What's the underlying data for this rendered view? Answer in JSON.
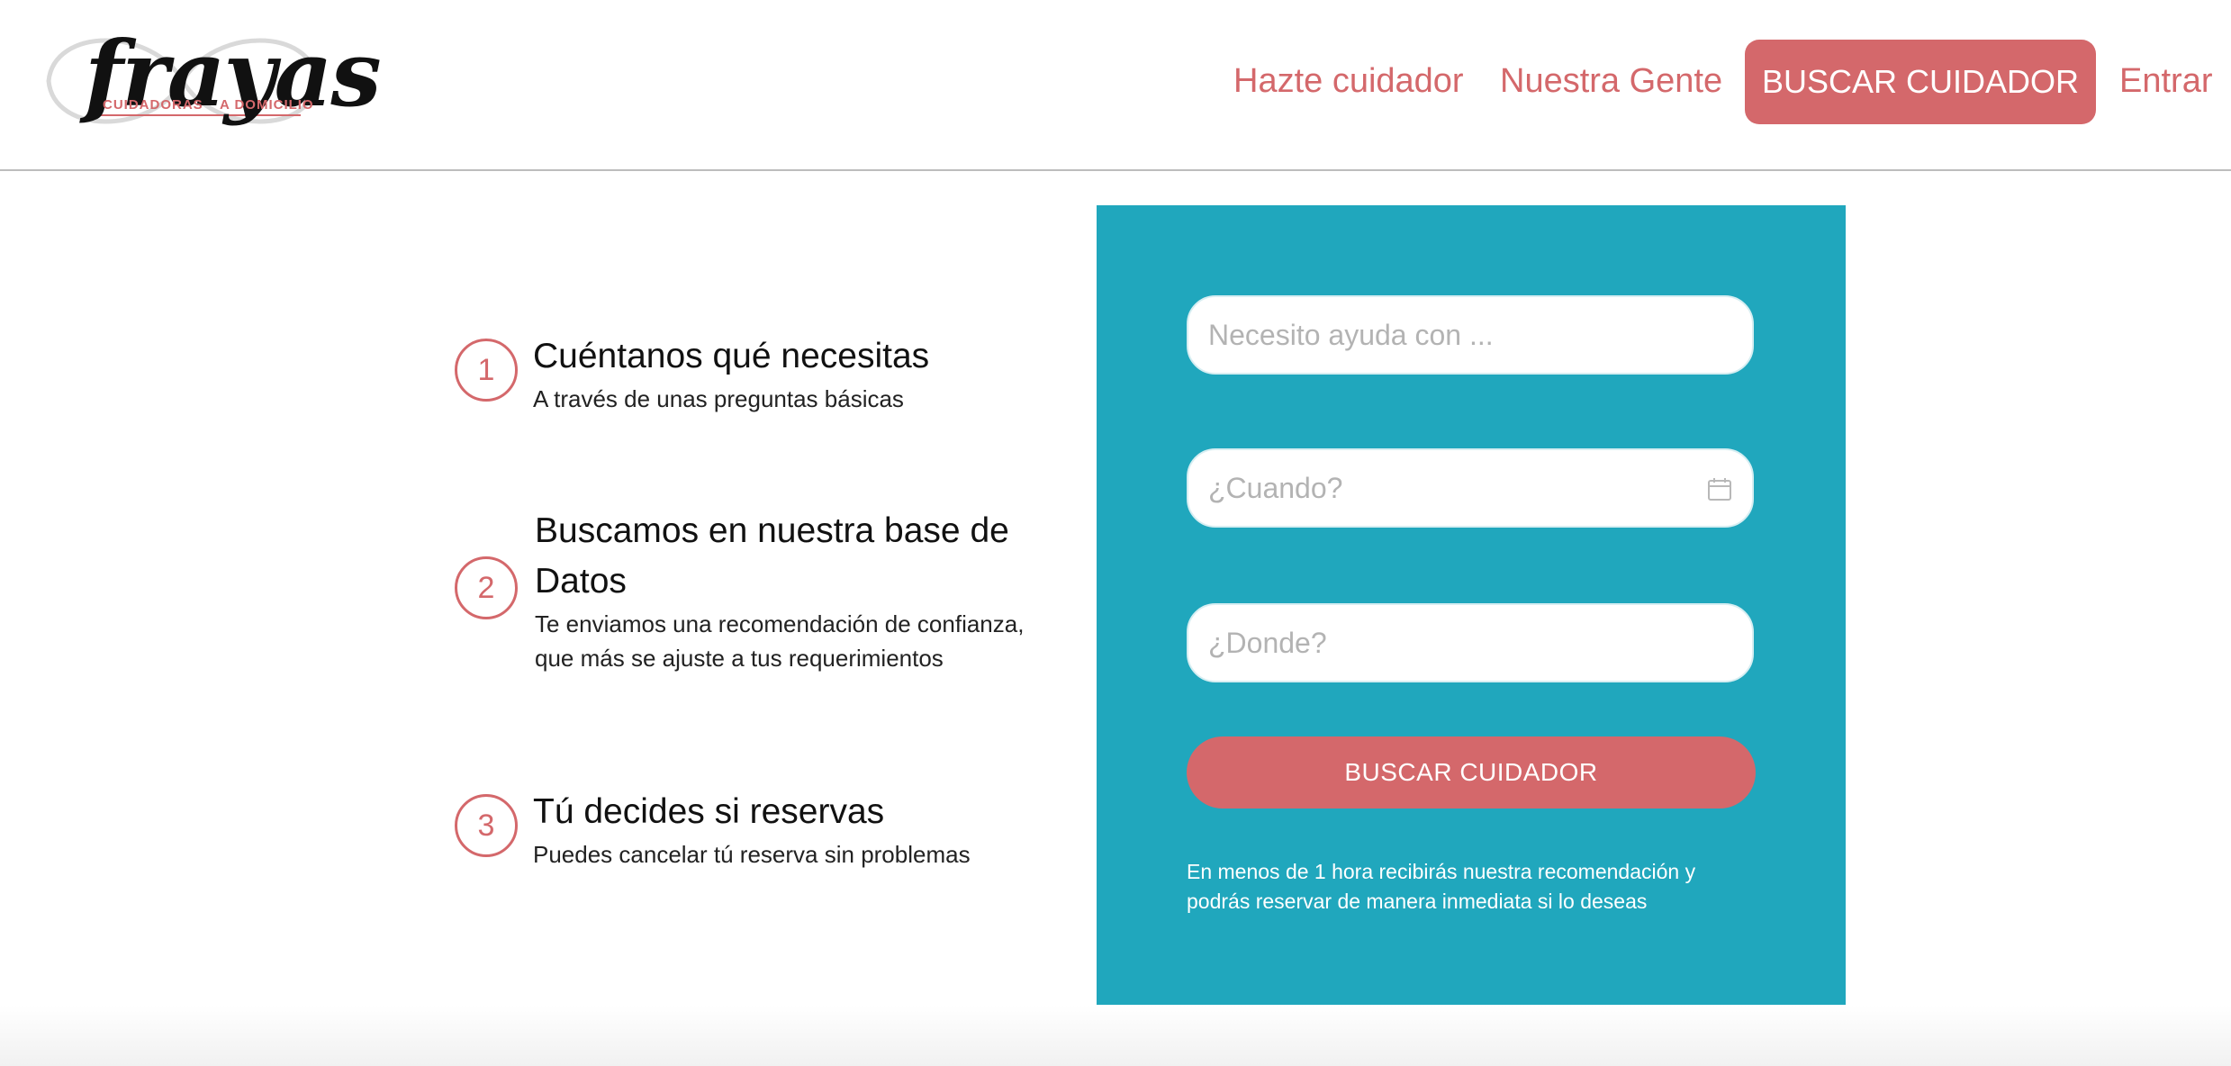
{
  "brand": {
    "name": "frayas",
    "tagline_left": "CUIDADORAS",
    "tagline_right": "A DOMICILIO",
    "accent_color": "#d4686b",
    "panel_color": "#20a7bd"
  },
  "nav": {
    "items": [
      {
        "label": "Hazte cuidador"
      },
      {
        "label": "Nuestra Gente"
      }
    ],
    "cta_label": "BUSCAR CUIDADOR",
    "login_label": "Entrar"
  },
  "steps": [
    {
      "number": "1",
      "title": "Cuéntanos qué necesitas",
      "desc_lines": [
        "A través de unas preguntas básicas"
      ]
    },
    {
      "number": "2",
      "title_lines": [
        "Buscamos en nuestra base de",
        "Datos"
      ],
      "desc_lines": [
        "Te enviamos una recomendación de confianza,",
        "que más se ajuste a tus requerimientos"
      ]
    },
    {
      "number": "3",
      "title": "Tú decides si reservas",
      "desc_lines": [
        "Puedes cancelar tú reserva sin problemas"
      ]
    }
  ],
  "search": {
    "need_placeholder": "Necesito ayuda con ...",
    "when_placeholder": "¿Cuando?",
    "where_placeholder": "¿Donde?",
    "submit_label": "BUSCAR CUIDADOR",
    "note_lines": [
      "En menos de 1 hora recibirás nuestra recomendación y",
      "podrás reservar de manera inmediata si lo deseas"
    ],
    "calendar_icon": "calendar-icon"
  }
}
